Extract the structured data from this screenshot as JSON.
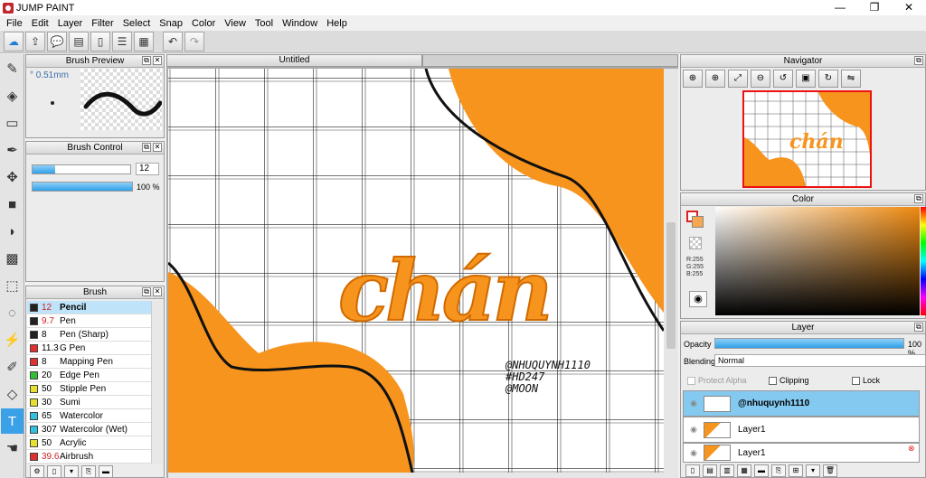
{
  "app": {
    "title": "JUMP PAINT",
    "min": "—",
    "restore": "❐",
    "close": "✕"
  },
  "menu": [
    "File",
    "Edit",
    "Layer",
    "Filter",
    "Select",
    "Snap",
    "Color",
    "View",
    "Tool",
    "Window",
    "Help"
  ],
  "toolbar_icons": [
    "cloud-icon",
    "export-icon",
    "chat-icon",
    "comment-icon",
    "page-icon",
    "list-icon",
    "grid-icon",
    "undo-icon",
    "redo-icon"
  ],
  "tools": [
    "brush-icon",
    "eraser-icon",
    "rectangle-icon",
    "pen-tool-icon",
    "move-icon",
    "fill-rect-icon",
    "bucket-icon",
    "gradient-icon",
    "select-rect-icon",
    "lasso-icon",
    "magic-wand-icon",
    "select-pen-icon",
    "select-eraser-icon",
    "text-icon",
    "hand-icon"
  ],
  "brush_preview": {
    "title": "Brush Preview",
    "size_label": "° 0.51mm"
  },
  "brush_control": {
    "title": "Brush Control",
    "size_value": "12",
    "opacity_value": "100 %",
    "size_fraction": 0.23,
    "opacity_fraction": 1.0
  },
  "brush": {
    "title": "Brush",
    "items": [
      {
        "size": "12",
        "name": "Pencil",
        "color": "#222222",
        "selected": true,
        "red": true
      },
      {
        "size": "9.7",
        "name": "Pen",
        "color": "#222222",
        "selected": false,
        "red": true
      },
      {
        "size": "8",
        "name": "Pen (Sharp)",
        "color": "#222222",
        "selected": false,
        "red": false
      },
      {
        "size": "11.3",
        "name": "G Pen",
        "color": "#e03030",
        "selected": false,
        "red": false
      },
      {
        "size": "8",
        "name": "Mapping Pen",
        "color": "#e03030",
        "selected": false,
        "red": false
      },
      {
        "size": "20",
        "name": "Edge Pen",
        "color": "#30c030",
        "selected": false,
        "red": false
      },
      {
        "size": "50",
        "name": "Stipple Pen",
        "color": "#e8e030",
        "selected": false,
        "red": false
      },
      {
        "size": "30",
        "name": "Sumi",
        "color": "#e8e030",
        "selected": false,
        "red": false
      },
      {
        "size": "65",
        "name": "Watercolor",
        "color": "#30c0e0",
        "selected": false,
        "red": false
      },
      {
        "size": "307",
        "name": "Watercolor (Wet)",
        "color": "#30c0e0",
        "selected": false,
        "red": false
      },
      {
        "size": "50",
        "name": "Acrylic",
        "color": "#e8e030",
        "selected": false,
        "red": false
      },
      {
        "size": "39.6",
        "name": "Airbrush",
        "color": "#e03030",
        "selected": false,
        "red": true
      }
    ]
  },
  "document": {
    "tab": "Untitled"
  },
  "artwork": {
    "lettering": "chán",
    "credits": [
      "@NHUQUYNH1110",
      "#HD247",
      "@MOON"
    ],
    "orange": "#f7941d"
  },
  "navigator": {
    "title": "Navigator",
    "buttons": [
      "zoom-fit-icon",
      "zoom-in-icon",
      "fit-screen-icon",
      "zoom-out-icon",
      "rotate-left-icon",
      "actual-size-icon",
      "rotate-right-icon",
      "flip-icon"
    ]
  },
  "color": {
    "title": "Color",
    "r": "R:255",
    "g": "G:255",
    "b": "B:255"
  },
  "layer": {
    "title": "Layer",
    "opacity_label": "Opacity",
    "opacity_value": "100 %",
    "blending_label": "Blending",
    "blending_value": "Normal",
    "protect_alpha": "Protect Alpha",
    "clipping": "Clipping",
    "lock": "Lock",
    "layers": [
      {
        "name": "@nhuquynh1110",
        "selected": true
      },
      {
        "name": "Layer1",
        "selected": false
      },
      {
        "name": "Layer1",
        "selected": false
      }
    ]
  }
}
